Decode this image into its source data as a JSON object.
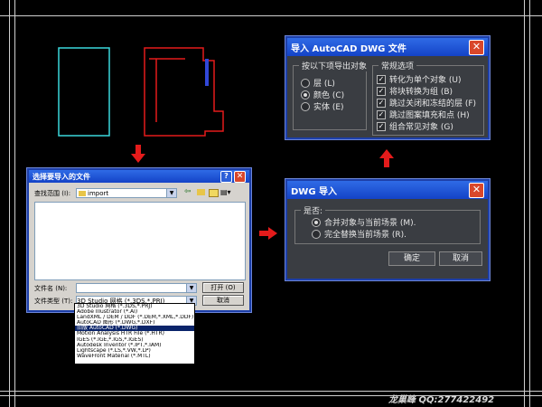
{
  "colors": {
    "cyan_rect": "#3ad7dc",
    "red_drawing": "#e41b1b",
    "arrows": "#e41b1b",
    "guides": "#cfcfcf",
    "title_blue": "#1d4fd6"
  },
  "import_dialog": {
    "title": "导入 AutoCAD DWG 文件",
    "export_group": {
      "label": "按以下项导出对象",
      "options": [
        "层 (L)",
        "颜色 (C)",
        "实体 (E)"
      ],
      "selected_index": 1
    },
    "general_group": {
      "label": "常规选项",
      "items": [
        {
          "label": "转化为单个对象 (U)",
          "checked": true
        },
        {
          "label": "将块转换为组 (B)",
          "checked": true
        },
        {
          "label": "跳过关闭和冻结的层 (F)",
          "checked": true
        },
        {
          "label": "跳过图案填充和点 (H)",
          "checked": true
        },
        {
          "label": "组合常见对象 (G)",
          "checked": true
        }
      ]
    }
  },
  "merge_dialog": {
    "title": "DWG 导入",
    "group_label": "是否:",
    "options": [
      "合并对象与当前场景 (M).",
      "完全替换当前场景 (R)."
    ],
    "selected_index": 0,
    "ok_label": "确定",
    "cancel_label": "取消"
  },
  "file_dialog": {
    "title": "选择要导入的文件",
    "help_label": "?",
    "lookin_label": "查找范围 (I):",
    "lookin_value": "import",
    "filename_label": "文件名 (N):",
    "filename_value": "",
    "filetype_label": "文件类型 (T):",
    "filetype_value": "3D Studio 网格 (*.3DS,*.PRJ)",
    "open_label": "打开 (O)",
    "cancel_label": "取消",
    "filetype_options": [
      "3D Studio 网格 (*.3DS,*.PRJ)",
      "Adobe Illustrator (*.AI)",
      "LandXML / DEM / DDF (*.DEM,*.XML,*.DDF)",
      "AutoCAD 图形 (*.DWG,*.DXF)",
      "旧版 AutoCAD (*.DWG)",
      "Motion Analysis HTR File (*.HTR)",
      "IGES (*.IGE,*.IGS,*.IGES)",
      "Autodesk Inventor (*.IPT,*.IAM)",
      "Lightscape (*.LS,*.VW,*.LP)",
      "WaveFront Material (*.MTL)"
    ],
    "filetype_selected_index": 4
  },
  "watermark": "龙巢峰   QQ:277422492"
}
